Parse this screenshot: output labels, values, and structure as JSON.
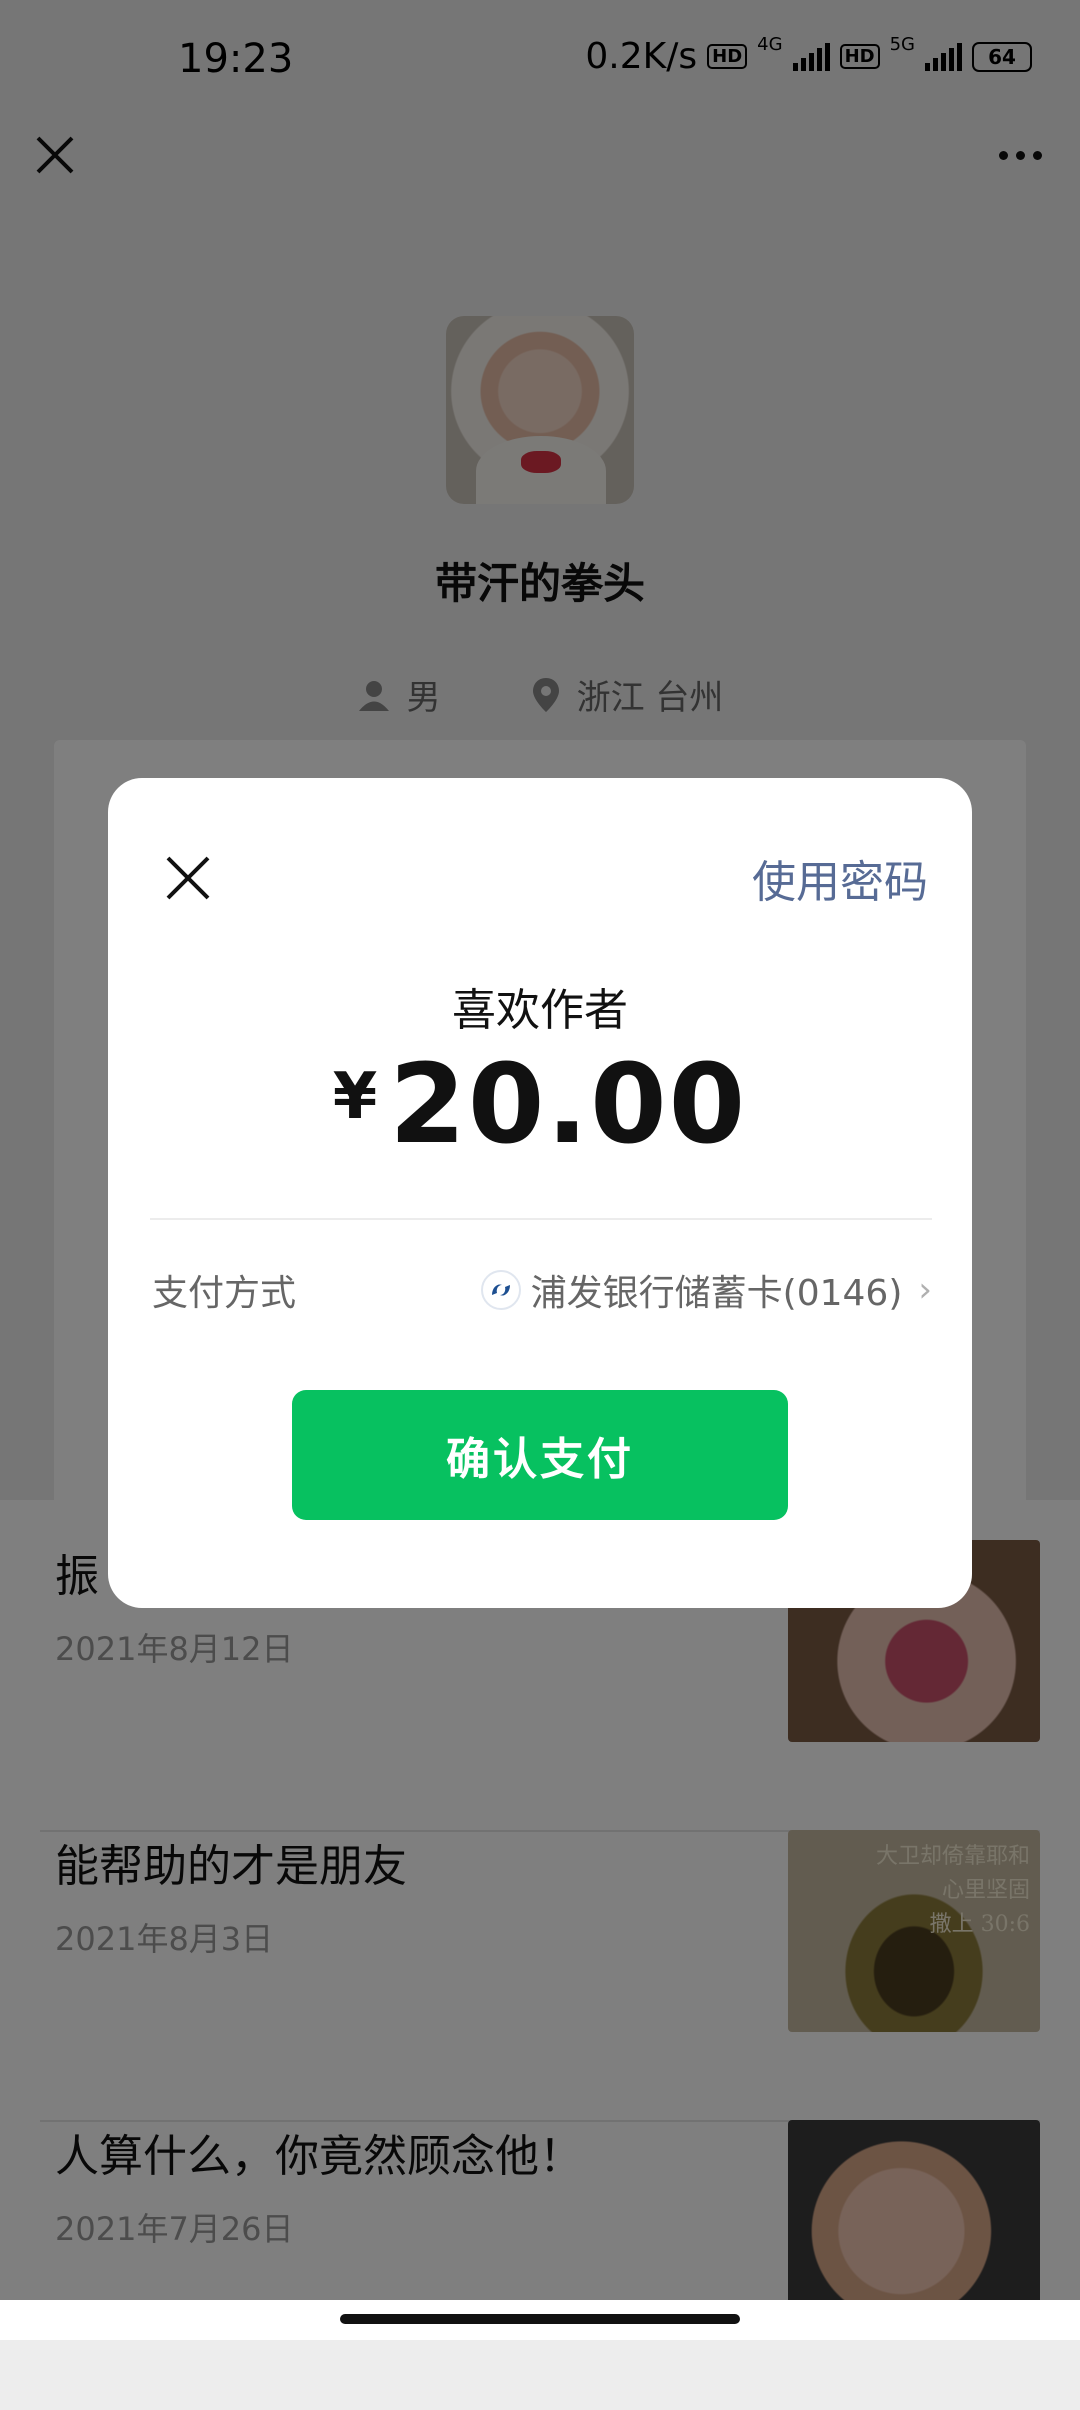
{
  "statusbar": {
    "time": "19:23",
    "net_speed": "0.2K/s",
    "sim1_badge": "HD",
    "sim1_net": "4G",
    "sim2_badge": "HD",
    "sim2_net": "5G",
    "battery": "64"
  },
  "profile": {
    "nickname": "带汗的拳头",
    "gender": "男",
    "location": "浙江  台州"
  },
  "articles": [
    {
      "title": "振",
      "date": "2021年8月12日"
    },
    {
      "title": "能帮助的才是朋友",
      "date": "2021年8月3日",
      "thumb_text": "大卫却倚靠耶和\n心里坚固\n撒上 30:6"
    },
    {
      "title": "人算什么，你竟然顾念他！",
      "date": "2021年7月26日"
    }
  ],
  "dialog": {
    "password_link": "使用密码",
    "subject": "喜欢作者",
    "currency": "¥",
    "amount": "20.00",
    "method_label": "支付方式",
    "method_value": "浦发银行储蓄卡(0146)",
    "confirm_label": "确认支付"
  },
  "colors": {
    "confirm_green": "#07c160",
    "link_blue": "#576b95",
    "overlay": "rgba(0,0,0,0.5)"
  },
  "icons": [
    "close-icon",
    "more-icon",
    "person-icon",
    "location-icon",
    "spdb-bank-icon",
    "chevron-right-icon"
  ]
}
